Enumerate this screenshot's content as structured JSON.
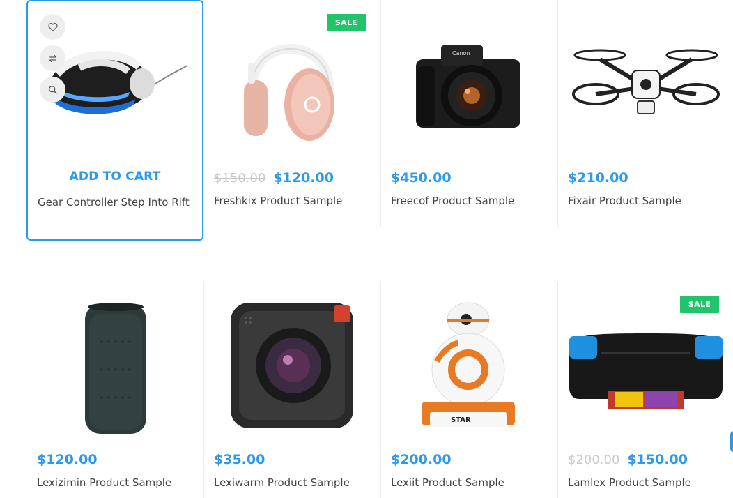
{
  "colors": {
    "accent": "#2b9ae8",
    "sale_badge": "#21c46a",
    "old_price": "#c9c9c9",
    "text": "#444444"
  },
  "actions": {
    "wishlist_icon": "heart-icon",
    "compare_icon": "compare-icon",
    "quickview_icon": "search-icon"
  },
  "products": [
    {
      "name": "Gear Controller Step Into Rift",
      "price": "",
      "old_price": "",
      "add_to_cart": "ADD TO CART",
      "sale": ""
    },
    {
      "name": "Freshkix Product Sample",
      "price": "$120.00",
      "old_price": "$150.00",
      "sale": "SALE"
    },
    {
      "name": "Freecof Product Sample",
      "price": "$450.00",
      "old_price": "",
      "sale": ""
    },
    {
      "name": "Fixair Product Sample",
      "price": "$210.00",
      "old_price": "",
      "sale": ""
    },
    {
      "name": "Lexizimin Product Sample",
      "price": "$120.00",
      "old_price": "",
      "sale": ""
    },
    {
      "name": "Lexiwarm Product Sample",
      "price": "$35.00",
      "old_price": "",
      "sale": ""
    },
    {
      "name": "Lexiit Product Sample",
      "price": "$200.00",
      "old_price": "",
      "sale": ""
    },
    {
      "name": "Lamlex Product Sample",
      "price": "$150.00",
      "old_price": "$200.00",
      "sale": "SALE"
    }
  ]
}
